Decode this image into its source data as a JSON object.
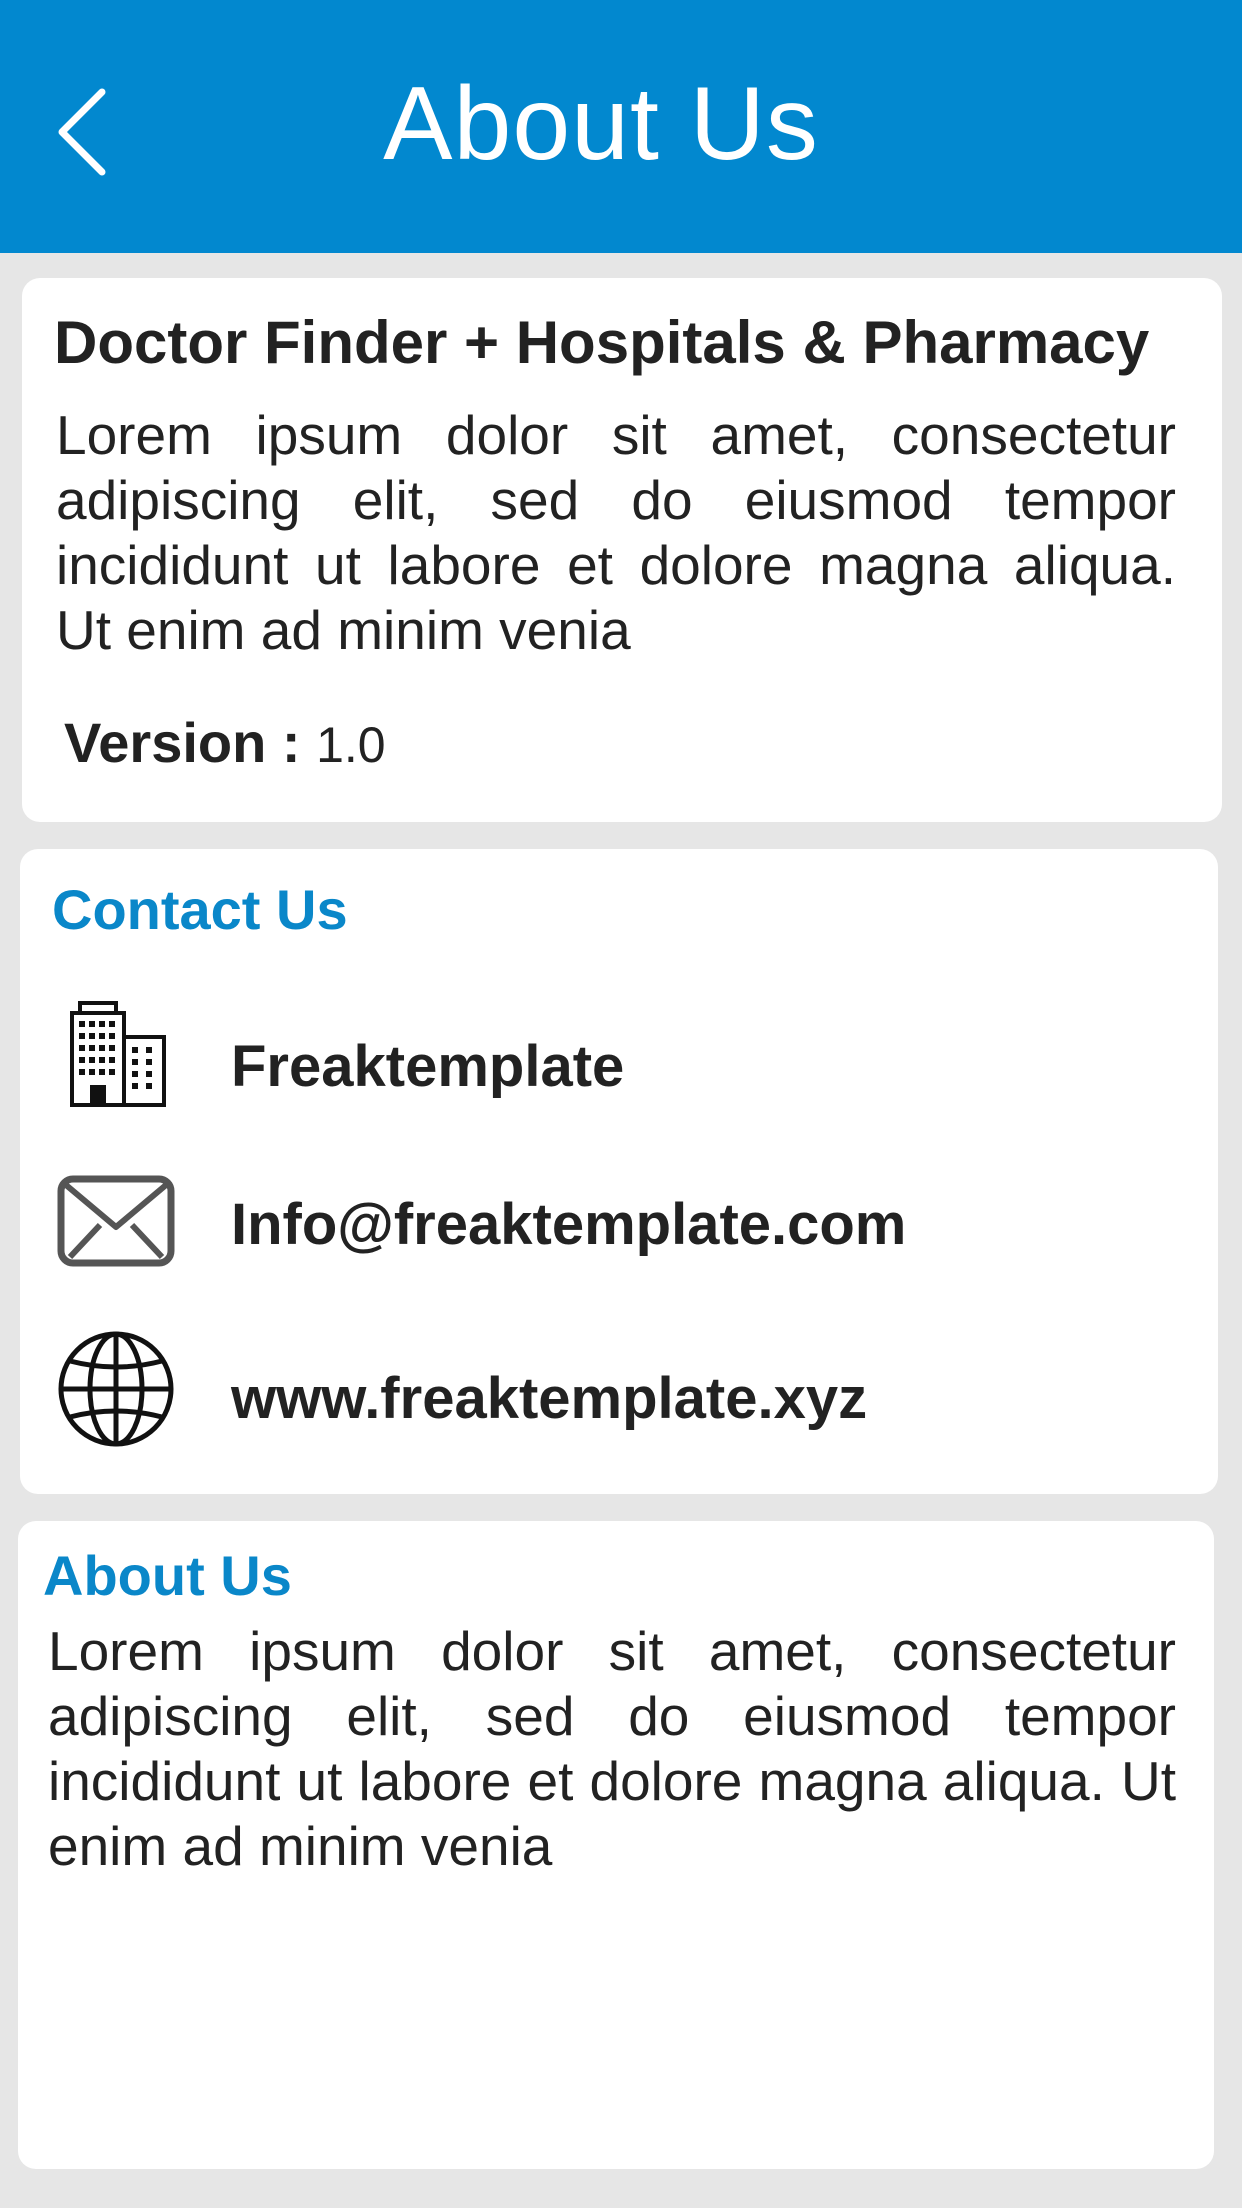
{
  "header": {
    "title": "About Us",
    "back_icon": "chevron-left-icon"
  },
  "app_card": {
    "name": "Doctor Finder + Hospitals & Pharmacy",
    "description": "Lorem ipsum dolor sit amet, consectetur adipiscing elit, sed do eiusmod tempor incididunt  ut labore et dolore magna aliqua. Ut enim ad minim venia",
    "version_label": "Version :",
    "version_value": "1.0"
  },
  "contact": {
    "title": "Contact Us",
    "items": [
      {
        "icon": "building-icon",
        "text": "Freaktemplate"
      },
      {
        "icon": "mail-icon",
        "text": "Info@freaktemplate.com"
      },
      {
        "icon": "globe-icon",
        "text": "www.freaktemplate.xyz"
      }
    ]
  },
  "about": {
    "title": "About Us",
    "body": "Lorem ipsum dolor sit amet, consectetur adipiscing elit, sed do eiusmod tempor incididunt  ut labore et dolore magna aliqua. Ut enim ad minim venia"
  },
  "colors": {
    "header_bg": "#0288cf",
    "accent": "#0a87c9",
    "page_bg": "#e6e6e6",
    "card_bg": "#ffffff"
  }
}
